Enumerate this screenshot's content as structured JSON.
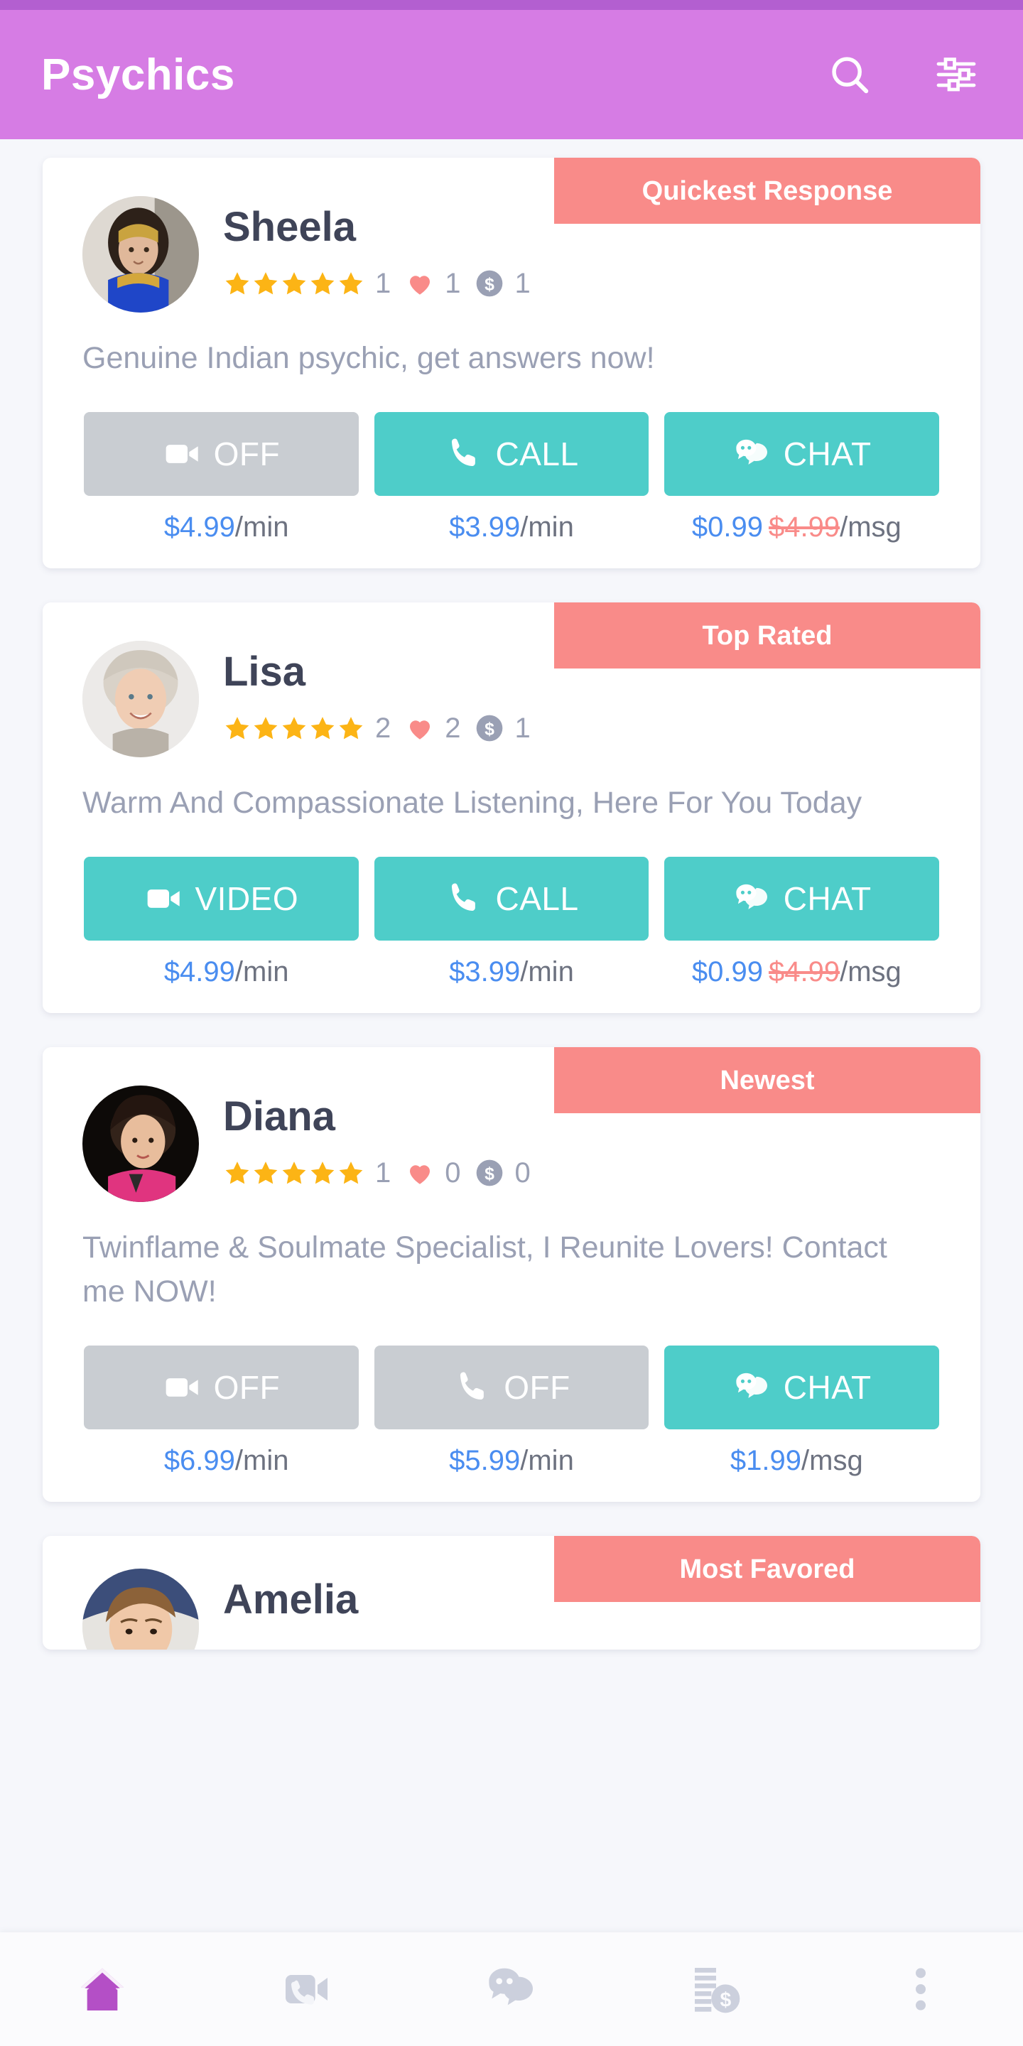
{
  "appbar": {
    "title": "Psychics",
    "search_icon": "search-icon",
    "filter_icon": "filter-sliders-icon",
    "background": "#d67ce4"
  },
  "theme": {
    "accent_purple": "#d67ce4",
    "badge_pink": "#f98b89",
    "action_on_teal": "#4ecdc9",
    "action_off_gray": "#c9cdd2",
    "price_blue": "#4a8df0",
    "star_gold": "#fcb415",
    "heart_pink": "#f98b89",
    "page_background": "#f6f7fb"
  },
  "cards": [
    {
      "name": "Sheela",
      "badge": "Quickest Response",
      "rating_stars": 5,
      "reviews": "1",
      "favorites": "1",
      "earnings": "1",
      "bio": "Genuine Indian psychic, get answers now!",
      "actions": [
        {
          "icon": "video-camera-icon",
          "label": "OFF",
          "enabled": false
        },
        {
          "icon": "phone-icon",
          "label": "CALL",
          "enabled": true
        },
        {
          "icon": "chat-bubbles-icon",
          "label": "CHAT",
          "enabled": true
        }
      ],
      "prices": [
        {
          "amount": "$4.99",
          "old": "",
          "unit": "/min"
        },
        {
          "amount": "$3.99",
          "old": "",
          "unit": "/min"
        },
        {
          "amount": "$0.99",
          "old": "$4.99",
          "unit": "/msg"
        }
      ]
    },
    {
      "name": "Lisa",
      "badge": "Top Rated",
      "rating_stars": 5,
      "reviews": "2",
      "favorites": "2",
      "earnings": "1",
      "bio": "Warm And Compassionate Listening, Here For You Today",
      "actions": [
        {
          "icon": "video-camera-icon",
          "label": "VIDEO",
          "enabled": true
        },
        {
          "icon": "phone-icon",
          "label": "CALL",
          "enabled": true
        },
        {
          "icon": "chat-bubbles-icon",
          "label": "CHAT",
          "enabled": true
        }
      ],
      "prices": [
        {
          "amount": "$4.99",
          "old": "",
          "unit": "/min"
        },
        {
          "amount": "$3.99",
          "old": "",
          "unit": "/min"
        },
        {
          "amount": "$0.99",
          "old": "$4.99",
          "unit": "/msg"
        }
      ]
    },
    {
      "name": "Diana",
      "badge": "Newest",
      "rating_stars": 5,
      "reviews": "1",
      "favorites": "0",
      "earnings": "0",
      "bio": "Twinflame & Soulmate Specialist, I Reunite Lovers! Contact me NOW!",
      "actions": [
        {
          "icon": "video-camera-icon",
          "label": "OFF",
          "enabled": false
        },
        {
          "icon": "phone-icon",
          "label": "OFF",
          "enabled": false
        },
        {
          "icon": "chat-bubbles-icon",
          "label": "CHAT",
          "enabled": true
        }
      ],
      "prices": [
        {
          "amount": "$6.99",
          "old": "",
          "unit": "/min"
        },
        {
          "amount": "$5.99",
          "old": "",
          "unit": "/min"
        },
        {
          "amount": "$1.99",
          "old": "",
          "unit": "/msg"
        }
      ]
    },
    {
      "name": "Amelia",
      "badge": "Most Favored",
      "partial": true
    }
  ],
  "bottomnav": {
    "items": [
      {
        "icon": "home-icon",
        "active": true
      },
      {
        "icon": "video-call-icon",
        "active": false
      },
      {
        "icon": "chat-icon",
        "active": false
      },
      {
        "icon": "billing-money-icon",
        "active": false
      },
      {
        "icon": "more-vertical-icon",
        "active": false
      }
    ],
    "active_color": "#b44fc6",
    "inactive_color": "#ccd0dd"
  }
}
